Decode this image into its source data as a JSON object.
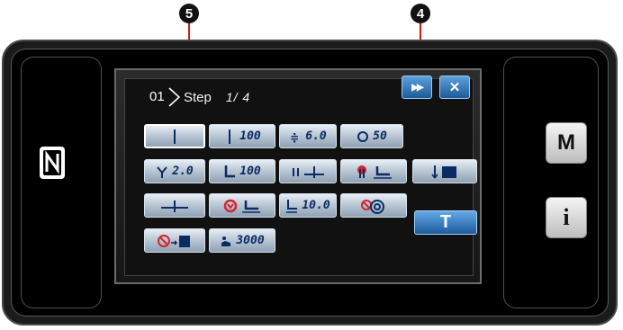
{
  "callouts": [
    {
      "id": "5",
      "label": "5"
    },
    {
      "id": "4",
      "label": "4"
    }
  ],
  "step": {
    "number": "01",
    "label": "Step",
    "count": "1/ 4"
  },
  "top_buttons": {
    "forward_icon": "fast-forward-icon",
    "forward_glyph": "▶▶",
    "close_icon": "close-icon",
    "close_glyph": "✕"
  },
  "hardware_buttons": {
    "m_label": "M",
    "i_label": "i"
  },
  "grid": {
    "row1": [
      {
        "name": "thread-cell",
        "value": ""
      },
      {
        "name": "stitch-length-cell",
        "value": "100"
      },
      {
        "name": "thread-tension-cell",
        "value": "6.0"
      },
      {
        "name": "presser-pressure-cell",
        "value": "50"
      }
    ],
    "row2": [
      {
        "name": "feed-cell",
        "value": "2.0"
      },
      {
        "name": "presser-foot-cell",
        "value": "100"
      },
      {
        "name": "needle-position-cell",
        "value": ""
      },
      {
        "name": "needle-stop-presser-cell",
        "value": ""
      },
      {
        "name": "fabric-cell",
        "value": ""
      }
    ],
    "row3": [
      {
        "name": "stitch-line-cell",
        "value": ""
      },
      {
        "name": "thread-trim-presser-cell",
        "value": ""
      },
      {
        "name": "presser-lift-cell",
        "value": "10.0"
      },
      {
        "name": "thread-wiper-cell",
        "value": ""
      },
      {
        "name": "teach-cell",
        "value": "T"
      }
    ],
    "row4": [
      {
        "name": "sensor-cell",
        "value": ""
      },
      {
        "name": "max-speed-cell",
        "value": "3000"
      }
    ]
  },
  "colors": {
    "accent_blue": "#2a6db0",
    "button_text": "#0b2b63",
    "callout_line": "#d21a1a"
  }
}
